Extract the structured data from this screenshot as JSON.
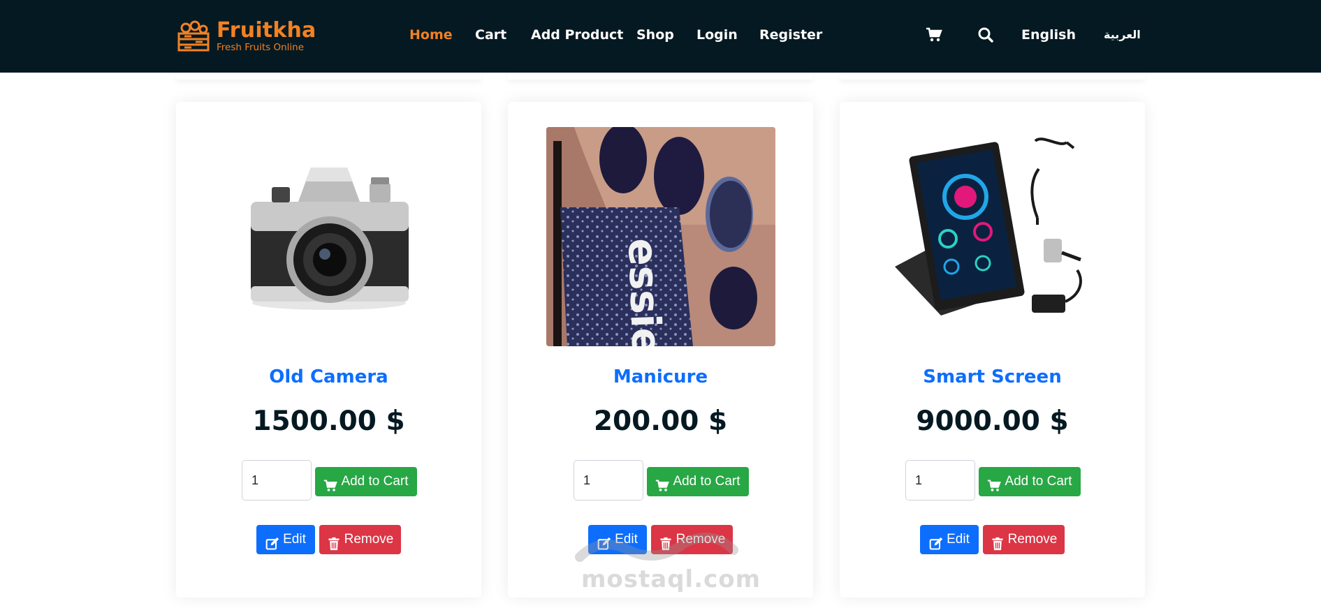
{
  "brand": {
    "name": "Fruitkha",
    "tagline": "Fresh Fruits Online",
    "accent": "#F28123",
    "header_bg": "#051922"
  },
  "nav": {
    "items": [
      {
        "label": "Home",
        "active": true
      },
      {
        "label": "Cart",
        "active": false
      },
      {
        "label": "Add Product",
        "active": false
      },
      {
        "label": "Shop",
        "active": false
      },
      {
        "label": "Login",
        "active": false
      },
      {
        "label": "Register",
        "active": false
      }
    ],
    "cart_icon": "shopping-cart-icon",
    "search_icon": "search-icon",
    "lang_en": "English",
    "lang_ar": "العربية"
  },
  "products": [
    {
      "name": "Old Camera",
      "price": "1500.00 $",
      "qty": "1",
      "add_label": "Add to Cart",
      "edit_label": "Edit",
      "remove_label": "Remove",
      "image": "camera-image"
    },
    {
      "name": "Manicure",
      "price": "200.00 $",
      "qty": "1",
      "add_label": "Add to Cart",
      "edit_label": "Edit",
      "remove_label": "Remove",
      "image": "nail-polish-image"
    },
    {
      "name": "Smart Screen",
      "price": "9000.00 $",
      "qty": "1",
      "add_label": "Add to Cart",
      "edit_label": "Edit",
      "remove_label": "Remove",
      "image": "smart-screen-image"
    }
  ],
  "colors": {
    "title": "#0D6EFD",
    "price": "#051922",
    "add": "#28a745",
    "edit": "#0d6efd",
    "remove": "#dc3545"
  },
  "watermark": "mostaql.com"
}
